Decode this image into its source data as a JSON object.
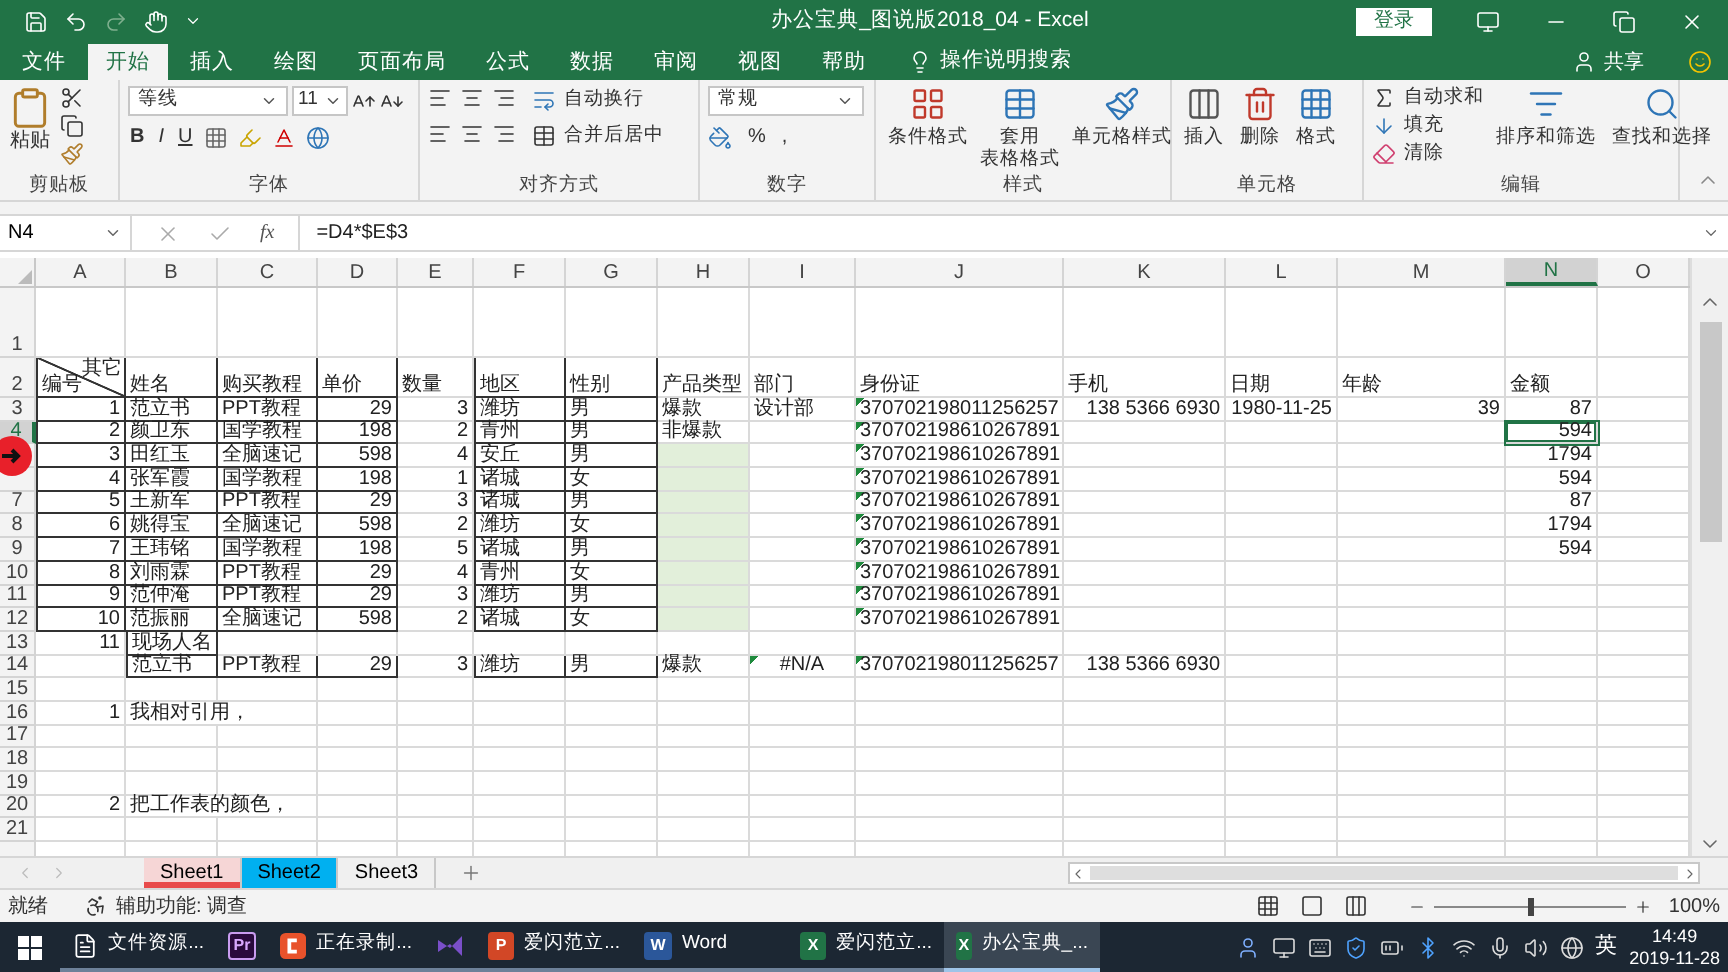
{
  "title_bar": {
    "title": "办公宝典_图说版2018_04  -  Excel",
    "login": "登录"
  },
  "tabs": [
    {
      "label": "文件",
      "selected": false
    },
    {
      "label": "开始",
      "selected": true
    },
    {
      "label": "插入",
      "selected": false
    },
    {
      "label": "绘图",
      "selected": false
    },
    {
      "label": "页面布局",
      "selected": false
    },
    {
      "label": "公式",
      "selected": false
    },
    {
      "label": "数据",
      "selected": false
    },
    {
      "label": "审阅",
      "selected": false
    },
    {
      "label": "视图",
      "selected": false
    },
    {
      "label": "帮助",
      "selected": false
    }
  ],
  "tell_me": "操作说明搜索",
  "share": "共享",
  "ribbon": {
    "clipboard": {
      "paste": "粘贴",
      "group": "剪贴板"
    },
    "font": {
      "family": "等线",
      "size": "11",
      "format_buttons": [
        "B",
        "I",
        "U"
      ],
      "group": "字体"
    },
    "alignment": {
      "wrap": "自动换行",
      "merge": "合并后居中",
      "group": "对齐方式"
    },
    "number": {
      "format": "常规",
      "percent": "%",
      "comma": ",",
      "group": "数字"
    },
    "styles": {
      "buttons": [
        {
          "lines": [
            "条件格式"
          ]
        },
        {
          "lines": [
            "套用",
            "表格格式"
          ]
        },
        {
          "lines": [
            "单元格样式"
          ]
        }
      ],
      "group": "样式"
    },
    "cells": {
      "buttons": [
        {
          "lines": [
            "插入"
          ]
        },
        {
          "lines": [
            "删除"
          ]
        },
        {
          "lines": [
            "格式"
          ]
        }
      ],
      "group": "单元格"
    },
    "editing": {
      "small": [
        "自动求和",
        "填充",
        "清除"
      ],
      "buttons": [
        {
          "lines": [
            "排序和筛选"
          ]
        },
        {
          "lines": [
            "查找和选择"
          ]
        }
      ],
      "group": "编辑"
    }
  },
  "formula_bar": {
    "name_box": "N4",
    "fx": "fx",
    "formula": "=D4*$E$3"
  },
  "grid": {
    "columns": [
      {
        "label": "A",
        "selected": false
      },
      {
        "label": "B",
        "selected": false
      },
      {
        "label": "C",
        "selected": false
      },
      {
        "label": "D",
        "selected": false
      },
      {
        "label": "E",
        "selected": false
      },
      {
        "label": "F",
        "selected": false
      },
      {
        "label": "G",
        "selected": false
      },
      {
        "label": "H",
        "selected": false
      },
      {
        "label": "I",
        "selected": false
      },
      {
        "label": "J",
        "selected": false
      },
      {
        "label": "K",
        "selected": false
      },
      {
        "label": "L",
        "selected": false
      },
      {
        "label": "M",
        "selected": false
      },
      {
        "label": "N",
        "selected": true
      },
      {
        "label": "O",
        "selected": false
      }
    ],
    "rows": [
      {
        "label": "1",
        "selected": false
      },
      {
        "label": "2",
        "selected": false,
        "cells": [
          {
            "kind": "diagonal",
            "top": "其它",
            "bottom": "编号"
          },
          {
            "kind": "text",
            "text": "姓名"
          },
          {
            "kind": "text",
            "text": "购买教程"
          },
          {
            "kind": "text",
            "text": "单价"
          },
          {
            "kind": "text",
            "text": "数量"
          },
          {
            "kind": "text",
            "text": "地区"
          },
          {
            "kind": "text",
            "text": "性别"
          },
          {
            "kind": "text",
            "text": "产品类型"
          },
          {
            "kind": "text",
            "text": "部门"
          },
          {
            "kind": "text",
            "text": "身份证"
          },
          {
            "kind": "text",
            "text": "手机"
          },
          {
            "kind": "text",
            "text": "日期"
          },
          {
            "kind": "text",
            "text": "年龄"
          },
          {
            "kind": "text",
            "text": "金额"
          }
        ]
      },
      {
        "label": "3",
        "selected": false,
        "cells": [
          {
            "kind": "number",
            "text": "1"
          },
          {
            "kind": "text",
            "text": "范立书"
          },
          {
            "kind": "text",
            "text": "PPT教程"
          },
          {
            "kind": "number",
            "text": "29"
          },
          {
            "kind": "number",
            "text": "3"
          },
          {
            "kind": "text",
            "text": "潍坊"
          },
          {
            "kind": "text",
            "text": "男"
          },
          {
            "kind": "text",
            "text": "爆款"
          },
          {
            "kind": "text",
            "text": "设计部"
          },
          {
            "kind": "flagged",
            "text": "370702198011256257"
          },
          {
            "kind": "number",
            "text": "138 5366 6930"
          },
          {
            "kind": "number",
            "text": "1980-11-25"
          },
          {
            "kind": "number",
            "text": "39"
          },
          {
            "kind": "number",
            "text": "87"
          }
        ]
      },
      {
        "label": "4",
        "selected": true,
        "cells": [
          {
            "kind": "number",
            "text": "2"
          },
          {
            "kind": "text",
            "text": "颜卫东"
          },
          {
            "kind": "text",
            "text": "国学教程"
          },
          {
            "kind": "number",
            "text": "198"
          },
          {
            "kind": "number",
            "text": "2"
          },
          {
            "kind": "text",
            "text": "青州"
          },
          {
            "kind": "text",
            "text": "男"
          },
          {
            "kind": "text",
            "text": "非爆款"
          },
          {
            "kind": "empty"
          },
          {
            "kind": "flagged",
            "text": "370702198610267891"
          },
          {
            "kind": "empty"
          },
          {
            "kind": "empty"
          },
          {
            "kind": "empty"
          },
          {
            "kind": "number",
            "text": "594"
          }
        ]
      },
      {
        "selected": false,
        "cells": [
          {
            "kind": "number",
            "text": "3"
          },
          {
            "kind": "text",
            "text": "田红玉"
          },
          {
            "kind": "text",
            "text": "全脑速记"
          },
          {
            "kind": "number",
            "text": "598"
          },
          {
            "kind": "number",
            "text": "4"
          },
          {
            "kind": "text",
            "text": "安丘"
          },
          {
            "kind": "text",
            "text": "男"
          },
          {
            "kind": "empty"
          },
          {
            "kind": "empty"
          },
          {
            "kind": "flagged",
            "text": "370702198610267891"
          },
          {
            "kind": "empty"
          },
          {
            "kind": "empty"
          },
          {
            "kind": "empty"
          },
          {
            "kind": "number",
            "text": "1794"
          }
        ]
      },
      {
        "selected": false,
        "cells": [
          {
            "kind": "number",
            "text": "4"
          },
          {
            "kind": "text",
            "text": "张军霞"
          },
          {
            "kind": "text",
            "text": "国学教程"
          },
          {
            "kind": "number",
            "text": "198"
          },
          {
            "kind": "number",
            "text": "1"
          },
          {
            "kind": "text",
            "text": "诸城"
          },
          {
            "kind": "text",
            "text": "女"
          },
          {
            "kind": "empty"
          },
          {
            "kind": "empty"
          },
          {
            "kind": "flagged",
            "text": "370702198610267891"
          },
          {
            "kind": "empty"
          },
          {
            "kind": "empty"
          },
          {
            "kind": "empty"
          },
          {
            "kind": "number",
            "text": "594"
          }
        ]
      },
      {
        "label": "7",
        "selected": false,
        "cells": [
          {
            "kind": "number",
            "text": "5"
          },
          {
            "kind": "text",
            "text": "王新军"
          },
          {
            "kind": "text",
            "text": "PPT教程"
          },
          {
            "kind": "number",
            "text": "29"
          },
          {
            "kind": "number",
            "text": "3"
          },
          {
            "kind": "text",
            "text": "诸城"
          },
          {
            "kind": "text",
            "text": "男"
          },
          {
            "kind": "empty"
          },
          {
            "kind": "empty"
          },
          {
            "kind": "flagged",
            "text": "370702198610267891"
          },
          {
            "kind": "empty"
          },
          {
            "kind": "empty"
          },
          {
            "kind": "empty"
          },
          {
            "kind": "number",
            "text": "87"
          }
        ]
      },
      {
        "label": "8",
        "selected": false,
        "cells": [
          {
            "kind": "number",
            "text": "6"
          },
          {
            "kind": "text",
            "text": "姚得宝"
          },
          {
            "kind": "text",
            "text": "全脑速记"
          },
          {
            "kind": "number",
            "text": "598"
          },
          {
            "kind": "number",
            "text": "2"
          },
          {
            "kind": "text",
            "text": "潍坊"
          },
          {
            "kind": "text",
            "text": "女"
          },
          {
            "kind": "empty"
          },
          {
            "kind": "empty"
          },
          {
            "kind": "flagged",
            "text": "370702198610267891"
          },
          {
            "kind": "empty"
          },
          {
            "kind": "empty"
          },
          {
            "kind": "empty"
          },
          {
            "kind": "number",
            "text": "1794"
          }
        ]
      },
      {
        "label": "9",
        "selected": false,
        "cells": [
          {
            "kind": "number",
            "text": "7"
          },
          {
            "kind": "text",
            "text": "王玮铭"
          },
          {
            "kind": "text",
            "text": "国学教程"
          },
          {
            "kind": "number",
            "text": "198"
          },
          {
            "kind": "number",
            "text": "5"
          },
          {
            "kind": "text",
            "text": "诸城"
          },
          {
            "kind": "text",
            "text": "男"
          },
          {
            "kind": "empty"
          },
          {
            "kind": "empty"
          },
          {
            "kind": "flagged",
            "text": "370702198610267891"
          },
          {
            "kind": "empty"
          },
          {
            "kind": "empty"
          },
          {
            "kind": "empty"
          },
          {
            "kind": "number",
            "text": "594"
          }
        ]
      },
      {
        "label": "10",
        "selected": false,
        "cells": [
          {
            "kind": "number",
            "text": "8"
          },
          {
            "kind": "text",
            "text": "刘雨霖"
          },
          {
            "kind": "text",
            "text": "PPT教程"
          },
          {
            "kind": "number",
            "text": "29"
          },
          {
            "kind": "number",
            "text": "4"
          },
          {
            "kind": "text",
            "text": "青州"
          },
          {
            "kind": "text",
            "text": "女"
          },
          {
            "kind": "empty"
          },
          {
            "kind": "empty"
          },
          {
            "kind": "flagged",
            "text": "370702198610267891"
          }
        ]
      },
      {
        "label": "11",
        "selected": false,
        "cells": [
          {
            "kind": "number",
            "text": "9"
          },
          {
            "kind": "text",
            "text": "范仲淹"
          },
          {
            "kind": "text",
            "text": "PPT教程"
          },
          {
            "kind": "number",
            "text": "29"
          },
          {
            "kind": "number",
            "text": "3"
          },
          {
            "kind": "text",
            "text": "潍坊"
          },
          {
            "kind": "text",
            "text": "男"
          },
          {
            "kind": "empty"
          },
          {
            "kind": "empty"
          },
          {
            "kind": "flagged",
            "text": "370702198610267891"
          }
        ]
      },
      {
        "label": "12",
        "selected": false,
        "cells": [
          {
            "kind": "number",
            "text": "10"
          },
          {
            "kind": "text",
            "text": "范振丽"
          },
          {
            "kind": "text",
            "text": "全脑速记"
          },
          {
            "kind": "number",
            "text": "598"
          },
          {
            "kind": "number",
            "text": "2"
          },
          {
            "kind": "text",
            "text": "诸城"
          },
          {
            "kind": "text",
            "text": "女"
          },
          {
            "kind": "empty"
          },
          {
            "kind": "empty"
          },
          {
            "kind": "flagged",
            "text": "370702198610267891"
          }
        ]
      },
      {
        "label": "13",
        "selected": false,
        "cells": [
          {
            "kind": "number",
            "text": "11"
          },
          {
            "kind": "text",
            "text": "现场人名"
          }
        ]
      },
      {
        "label": "14",
        "selected": false,
        "cells": [
          {
            "kind": "empty"
          },
          {
            "kind": "text",
            "text": "范立书"
          },
          {
            "kind": "text",
            "text": "PPT教程"
          },
          {
            "kind": "number",
            "text": "29"
          },
          {
            "kind": "number",
            "text": "3"
          },
          {
            "kind": "text",
            "text": "潍坊"
          },
          {
            "kind": "text",
            "text": "男"
          },
          {
            "kind": "text",
            "text": "爆款"
          },
          {
            "kind": "error",
            "text": "#N/A"
          },
          {
            "kind": "flagged",
            "text": "370702198011256257"
          },
          {
            "kind": "number",
            "text": "138 5366 6930"
          }
        ]
      },
      {
        "label": "15",
        "selected": false
      },
      {
        "label": "16",
        "selected": false,
        "cells": [
          {
            "kind": "number",
            "text": "1"
          },
          {
            "kind": "text",
            "text": "我相对引用，"
          }
        ]
      },
      {
        "label": "17",
        "selected": false
      },
      {
        "label": "18",
        "selected": false
      },
      {
        "label": "19",
        "selected": false
      },
      {
        "label": "20",
        "selected": false,
        "cells": [
          {
            "kind": "number",
            "text": "2"
          },
          {
            "kind": "text",
            "text": "把工作表的颜色，"
          }
        ]
      },
      {
        "label": "21",
        "selected": false
      }
    ]
  },
  "sheets": [
    {
      "label": "Sheet1",
      "selected": true,
      "color": "#e84a4a"
    },
    {
      "label": "Sheet2",
      "selected": false,
      "color": "#00b0f0"
    },
    {
      "label": "Sheet3",
      "selected": false
    }
  ],
  "status_bar": {
    "ready": "就绪",
    "accessibility": "辅助功能: 调查",
    "zoom": "100%",
    "level": 0.5
  },
  "taskbar": {
    "items": [
      {
        "kind": "folder",
        "label": "文件资源...",
        "selected": false
      },
      {
        "kind": "premiere",
        "badge": "Pr",
        "selected": false
      },
      {
        "kind": "recorder",
        "label": "正在录制...",
        "selected": false
      },
      {
        "kind": "vs",
        "selected": false
      },
      {
        "kind": "powerpoint",
        "badge": "P",
        "label": "爱闪范立...",
        "selected": false
      },
      {
        "kind": "word",
        "badge": "W",
        "label": "Word",
        "selected": false
      },
      {
        "kind": "excel",
        "badge": "X",
        "label": "爱闪范立...",
        "selected": false
      },
      {
        "kind": "excel",
        "badge": "X",
        "label": "办公宝典_...",
        "selected": true
      }
    ],
    "language": "英",
    "time": "14:49",
    "date": "2019-11-28"
  }
}
